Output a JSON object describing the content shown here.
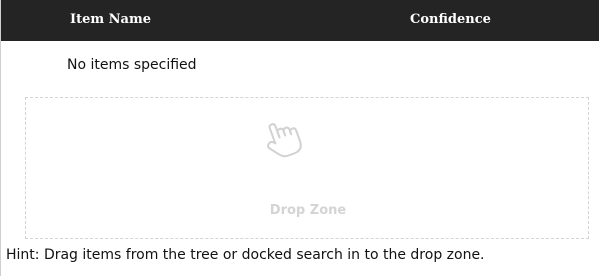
{
  "table": {
    "columns": [
      "Item Name",
      "Confidence"
    ],
    "empty_message": "No items specified"
  },
  "drop_zone": {
    "label": "Drop Zone",
    "icon": "hand-pointer-icon"
  },
  "hint": "Hint: Drag items from the tree or docked search in to the drop zone.",
  "colors": {
    "header_background": "#242424",
    "header_text": "#ffffff",
    "drop_zone_border": "#d3d3d3",
    "drop_zone_text": "#d4d4d4"
  }
}
